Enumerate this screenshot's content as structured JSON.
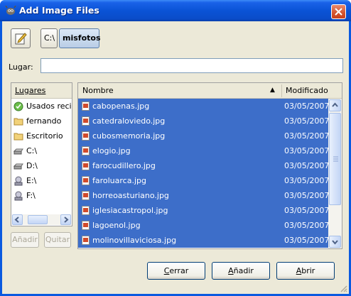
{
  "window": {
    "title": "Add Image Files"
  },
  "toolbar": {
    "path_segments": [
      "C:\\",
      "misfotos"
    ]
  },
  "location": {
    "label": "Lugar:",
    "value": ""
  },
  "places": {
    "header": "Lugares",
    "items": [
      {
        "label": "Usados recier",
        "icon": "recent-icon"
      },
      {
        "label": "fernando",
        "icon": "folder-icon"
      },
      {
        "label": "Escritorio",
        "icon": "folder-icon"
      },
      {
        "label": "C:\\",
        "icon": "drive-icon"
      },
      {
        "label": "D:\\",
        "icon": "drive-icon"
      },
      {
        "label": "E:\\",
        "icon": "network-drive-icon"
      },
      {
        "label": "F:\\",
        "icon": "network-drive-icon"
      }
    ],
    "add_label": "Añadir",
    "remove_label": "Quitar"
  },
  "files": {
    "columns": {
      "name": "Nombre",
      "modified": "Modificado"
    },
    "rows": [
      {
        "name": "cabopenas.jpg",
        "date": "03/05/2007"
      },
      {
        "name": "catedraloviedo.jpg",
        "date": "03/05/2007"
      },
      {
        "name": "cubosmemoria.jpg",
        "date": "03/05/2007"
      },
      {
        "name": "elogio.jpg",
        "date": "03/05/2007"
      },
      {
        "name": "farocudillero.jpg",
        "date": "03/05/2007"
      },
      {
        "name": "faroluarca.jpg",
        "date": "03/05/2007"
      },
      {
        "name": "horreoasturiano.jpg",
        "date": "03/05/2007"
      },
      {
        "name": "iglesiacastropol.jpg",
        "date": "03/05/2007"
      },
      {
        "name": "lagoenol.jpg",
        "date": "03/05/2007"
      },
      {
        "name": "molinovillaviciosa.jpg",
        "date": "03/05/2007"
      }
    ]
  },
  "buttons": {
    "cerrar": "Cerrar",
    "anadir": "Añadir",
    "abrir": "Abrir"
  },
  "colors": {
    "selection": "#3d6ec9",
    "titlebar": "#0a53d6",
    "dialog_bg": "#ece9d8"
  }
}
